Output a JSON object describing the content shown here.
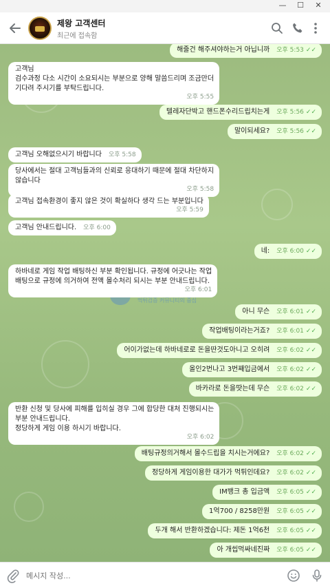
{
  "header": {
    "title": "제왕 고객센터",
    "subtitle": "최근에 접속함"
  },
  "composer": {
    "placeholder": "메시지 작성..."
  },
  "watermark": {
    "big": "ㅡ 질",
    "small": "먹튀검증 커뮤니티의 중심"
  },
  "messages": [
    {
      "dir": "out",
      "text": "해줄건 해주셔야하는거 아닙니까",
      "time": "오후 5:53"
    },
    {
      "dir": "in",
      "text": "고객님\n검수과정 다소 시간이 소요되시는 부분으로 양해 말씀드리며 조금만더\n기다려 주시기를 부탁드립니다.",
      "time": "오후 5:55"
    },
    {
      "dir": "out",
      "text": "텔레자단박고 핸드폰수리드립치는게",
      "time": "오후 5:56"
    },
    {
      "dir": "out",
      "text": "말이되세요?",
      "time": "오후 5:56"
    },
    {
      "dir": "in",
      "text": "고객님 오해없으시기 바랍니다",
      "time": "오후 5:58"
    },
    {
      "dir": "in",
      "text": "당사에서는 절대 고객님들과의 신뢰로 응대하기 때문에 절대 차단하지\n않습니다",
      "time": "오후 5:58"
    },
    {
      "dir": "in",
      "text": "고객님 접속환경이 좋지 않은 것이 확실하다 생각 드는 부분입니다",
      "time": "오후 5:59"
    },
    {
      "dir": "in",
      "text": "고객님 안내드립니다.",
      "time": "오후 6:00"
    },
    {
      "dir": "out",
      "text": "네:",
      "time": "오후 6:00"
    },
    {
      "dir": "in",
      "text": "하바네로 게임 작업 배팅하신 부분 확인됩니다. 규정에 어긋나는 작업\n배팅으로 규정에 의거하여 전액 몰수처리 되시는 부분 안내드립니다.",
      "time": "오후 6:01"
    },
    {
      "dir": "out",
      "text": "아니 무슨",
      "time": "오후 6:01"
    },
    {
      "dir": "out",
      "text": "작업배팅이라는거죠?",
      "time": "오후 6:01"
    },
    {
      "dir": "out",
      "text": "어이가없는데 하바네로로 돈을딴것도아니고 오히려",
      "time": "오후 6:02"
    },
    {
      "dir": "out",
      "text": "올인2번나고 3번째입금에서",
      "time": "오후 6:02"
    },
    {
      "dir": "out",
      "text": "바카라로 돈을땃는데 무슨",
      "time": "오후 6:02"
    },
    {
      "dir": "in",
      "text": "반환 신청 및 당사에 피해를 입히실 경우 그에 합당한 대처 진행되시는\n부분 안내드립니다.\n정당하게 게임 이용 하시기 바랍니다.",
      "time": "오후 6:02"
    },
    {
      "dir": "out",
      "text": "배팅규정의거해서 몰수드립을 치시는거에요?",
      "time": "오후 6:02"
    },
    {
      "dir": "out",
      "text": "정당하게 게임이용한 대가가 먹튀인데요?",
      "time": "오후 6:02"
    },
    {
      "dir": "out",
      "text": "IM뱅크 총 입금액",
      "time": "오후 6:05"
    },
    {
      "dir": "out",
      "text": "1억700 / 8258만원",
      "time": "오후 6:05"
    },
    {
      "dir": "out",
      "text": "두개 해서 반환하겠습니다: 제돈 1억6천",
      "time": "오후 6:05"
    },
    {
      "dir": "out",
      "text": "아 개씹먹싸네진짜",
      "time": "오후 6:05"
    }
  ]
}
